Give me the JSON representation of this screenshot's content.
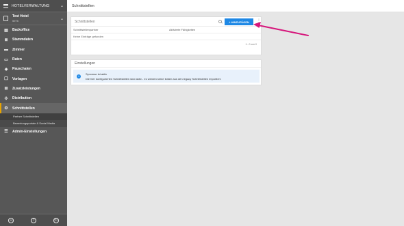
{
  "app": {
    "title": "HOTELVERWALTUNG",
    "hotel_name": "Test Hotel",
    "hotel_id": "5975"
  },
  "sidebar": {
    "items": [
      {
        "label": "Backoffice",
        "icon": "document-icon",
        "glyph": "▤"
      },
      {
        "label": "Stammdaten",
        "icon": "database-icon",
        "glyph": "≣"
      },
      {
        "label": "Zimmer",
        "icon": "bed-icon",
        "glyph": "▬"
      },
      {
        "label": "Raten",
        "icon": "card-icon",
        "glyph": "▭"
      },
      {
        "label": "Pauschalen",
        "icon": "tag-icon",
        "glyph": "◈"
      },
      {
        "label": "Vorlagen",
        "icon": "copy-icon",
        "glyph": "❐"
      },
      {
        "label": "Zusatzleistungen",
        "icon": "cart-icon",
        "glyph": "⊞"
      },
      {
        "label": "Distribution",
        "icon": "share-icon",
        "glyph": "✣"
      },
      {
        "label": "Schnittstellen",
        "icon": "plug-icon",
        "glyph": "⚙"
      }
    ],
    "subitems": [
      {
        "label": "Partner Schnittstellen"
      },
      {
        "label": "Bewertungsportale & Social Media"
      }
    ],
    "admin": {
      "label": "Admin-Einstellungen",
      "icon": "sliders-icon",
      "glyph": "☰"
    },
    "footer": {
      "user_glyph": "☺",
      "help_glyph": "?",
      "power_glyph": "⏻"
    }
  },
  "page": {
    "title": "Schnittstellen"
  },
  "interfaces_card": {
    "search_placeholder": "Schnittstellen",
    "add_button": "+ HINZUFÜGEN",
    "columns": [
      "Schnittstellenpartner",
      "Aktivierte Fähigkeiten"
    ],
    "empty_text": "Keine Einträge gefunden",
    "pagination": "1 - 0 von 0"
  },
  "settings_card": {
    "title": "Einstellungen",
    "info_line1": "Synxman ist aktiv",
    "info_line2": "Die hier konfigurierten Schnittstellen sind aktiv - es werden keine Daten aus den legacy Schnittstellen importiert."
  },
  "colors": {
    "accent": "#1e88e5",
    "annotation_arrow": "#d6177c",
    "sidebar_bg": "#575757",
    "active_marker": "#e8a400"
  }
}
